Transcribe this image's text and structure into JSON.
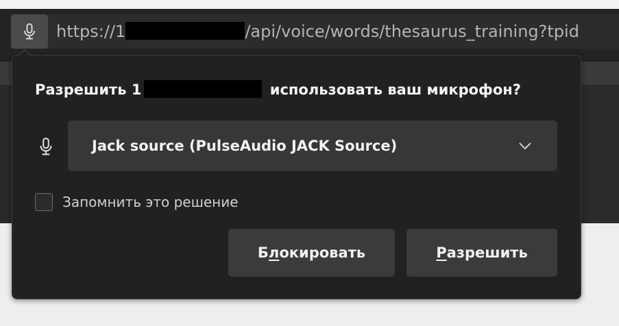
{
  "toolbar": {
    "url": {
      "scheme": "https://",
      "prefix": "1",
      "path": "/api/voice/words/thesaurus_training?tpid"
    },
    "permission_icon": "microphone-icon"
  },
  "popup": {
    "prompt": {
      "before": "Разрешить ",
      "host_prefix": "1",
      "after": " использовать ваш микрофон?"
    },
    "device": {
      "icon": "microphone-icon",
      "selected": "Jack source (PulseAudio JACK Source)",
      "chevron_icon": "chevron-down-icon"
    },
    "remember": {
      "label": "Запомнить это решение",
      "checked": false
    },
    "buttons": {
      "block": {
        "pre": "Б",
        "mnemonic": "л",
        "post": "окировать"
      },
      "allow": {
        "pre": "",
        "mnemonic": "Р",
        "post": "азрешить"
      }
    }
  }
}
